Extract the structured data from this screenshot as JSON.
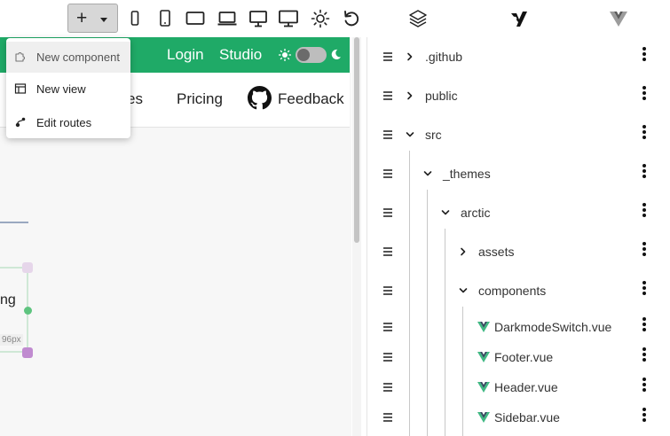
{
  "toolbar": {
    "add_button": {
      "plus": "+",
      "icon": "plus-icon"
    },
    "devices": [
      "mobile-small-icon",
      "mobile-icon",
      "tablet-icon",
      "laptop-icon",
      "desktop-icon",
      "desktop-wide-icon",
      "brightness-icon",
      "refresh-icon"
    ],
    "right_icons": [
      "layers-icon",
      "logo-icon",
      "vue-icon"
    ]
  },
  "preview": {
    "header_links": {
      "login": "Login",
      "studio": "Studio"
    },
    "nav_links": {
      "truncated": "es",
      "pricing": "Pricing",
      "feedback": "Feedback"
    },
    "canvas_text": "ng",
    "size_label": "96px",
    "colors": {
      "header_green": "#1faa67"
    }
  },
  "menu": {
    "items": [
      {
        "label": "New component",
        "icon": "puzzle-icon"
      },
      {
        "label": "New view",
        "icon": "layout-icon"
      },
      {
        "label": "Edit routes",
        "icon": "routes-icon"
      }
    ]
  },
  "tree": {
    "items": [
      {
        "label": ".github",
        "expanded": false
      },
      {
        "label": "public",
        "expanded": false
      },
      {
        "label": "src",
        "expanded": true
      },
      {
        "label": "_themes",
        "expanded": true
      },
      {
        "label": "arctic",
        "expanded": true
      },
      {
        "label": "assets",
        "expanded": false
      },
      {
        "label": "components",
        "expanded": true
      },
      {
        "label": "DarkmodeSwitch.vue",
        "file": true
      },
      {
        "label": "Footer.vue",
        "file": true
      },
      {
        "label": "Header.vue",
        "file": true
      },
      {
        "label": "Sidebar.vue",
        "file": true
      }
    ]
  }
}
